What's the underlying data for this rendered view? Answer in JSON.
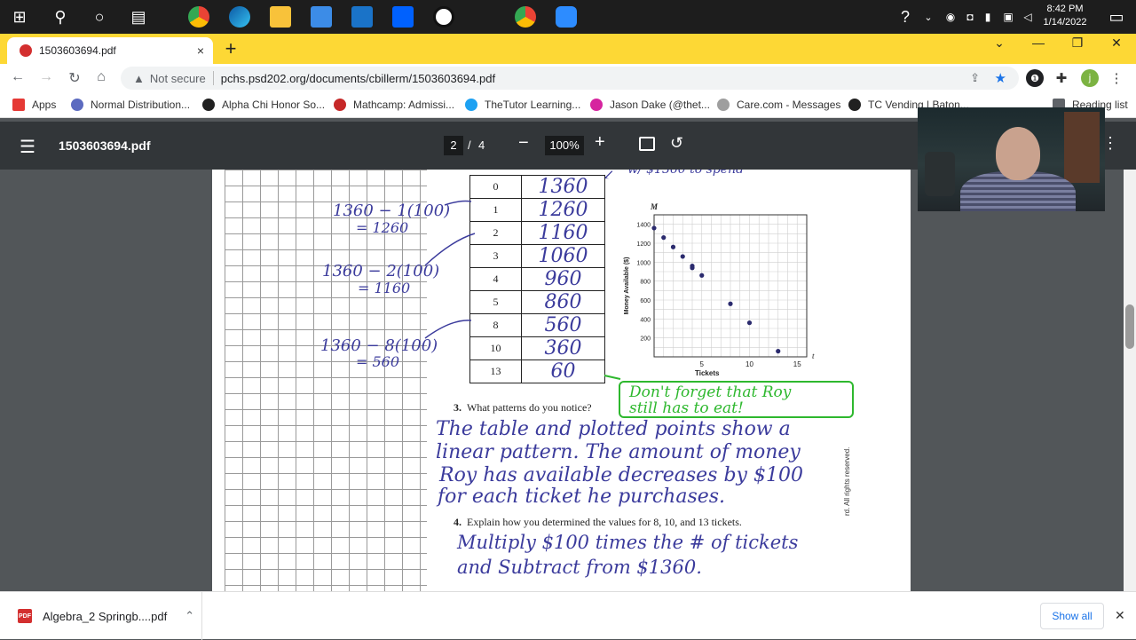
{
  "taskbar": {
    "clock_time": "8:42 PM",
    "clock_date": "1/14/2022"
  },
  "browser": {
    "tab_title": "1503603694.pdf",
    "tab_close": "×",
    "new_tab": "+",
    "minimize": "—",
    "maximize": "❐",
    "close": "✕",
    "not_secure": "Not secure",
    "url": "pchs.psd202.org/documents/cbillerm/1503603694.pdf",
    "profile_initial": "j",
    "bookmarks": [
      {
        "label": "Apps",
        "color": "#e53935"
      },
      {
        "label": "Normal Distribution...",
        "color": "#5c6bc0"
      },
      {
        "label": "Alpha Chi Honor So...",
        "color": "#212121"
      },
      {
        "label": "Mathcamp: Admissi...",
        "color": "#c62828"
      },
      {
        "label": "TheTutor Learning...",
        "color": "#1da1f2"
      },
      {
        "label": "Jason Dake (@thet...",
        "color": "#d6249f"
      },
      {
        "label": "Care.com - Messages",
        "color": "#9e9e9e"
      },
      {
        "label": "TC Vending | Baton...",
        "color": "#212121"
      },
      {
        "label": "Reading list",
        "color": "#5f6368"
      }
    ]
  },
  "pdf_toolbar": {
    "title": "1503603694.pdf",
    "page_current": "2",
    "page_sep": "/",
    "page_total": "4",
    "zoom": "100%"
  },
  "document": {
    "top_note": "w/ $1360 to spend",
    "table": {
      "tickets": [
        "0",
        "1",
        "2",
        "3",
        "4",
        "5",
        "8",
        "10",
        "13"
      ],
      "money": [
        "1360",
        "1260",
        "1160",
        "1060",
        "960",
        "860",
        "560",
        "360",
        "60"
      ]
    },
    "work": [
      {
        "line1": "1360 − 1(100)",
        "line2": "= 1260"
      },
      {
        "line1": "1360 − 2(100)",
        "line2": "= 1160"
      },
      {
        "line1": "1360 − 8(100)",
        "line2": "= 560"
      }
    ],
    "green_note_line1": "Don't forget that Roy",
    "green_note_line2": "still has to eat!",
    "q3_num": "3.",
    "q3_text": "What patterns do you notice?",
    "a3_lines": [
      "The table and plotted points show a",
      "linear pattern. The amount of money",
      "Roy has available decreases by $100",
      "for each ticket he purchases."
    ],
    "q4_num": "4.",
    "q4_text": "Explain how you determined the values for 8, 10, and 13 tickets.",
    "a4_lines": [
      "Multiply $100 times the # of tickets",
      "and Subtract from $1360."
    ],
    "rights": "rd. All rights reserved."
  },
  "chart_data": {
    "type": "scatter",
    "title": "",
    "xlabel": "Tickets",
    "ylabel": "Money Available ($)",
    "x_axis_var": "t",
    "y_axis_var": "M",
    "x": [
      0,
      1,
      2,
      3,
      4,
      4,
      5,
      8,
      10,
      13
    ],
    "y": [
      1360,
      1260,
      1160,
      1060,
      960,
      940,
      860,
      560,
      360,
      60
    ],
    "xlim": [
      0,
      16
    ],
    "ylim": [
      0,
      1500
    ],
    "xticks": [
      "5",
      "10",
      "15"
    ],
    "yticks": [
      "200",
      "400",
      "600",
      "800",
      "1000",
      "1200",
      "1400"
    ],
    "grid": true,
    "point_color": "#2b2b6e"
  },
  "downloads": {
    "file": "Algebra_2 Springb....pdf",
    "pdf_badge": "PDF",
    "show_all": "Show all"
  }
}
